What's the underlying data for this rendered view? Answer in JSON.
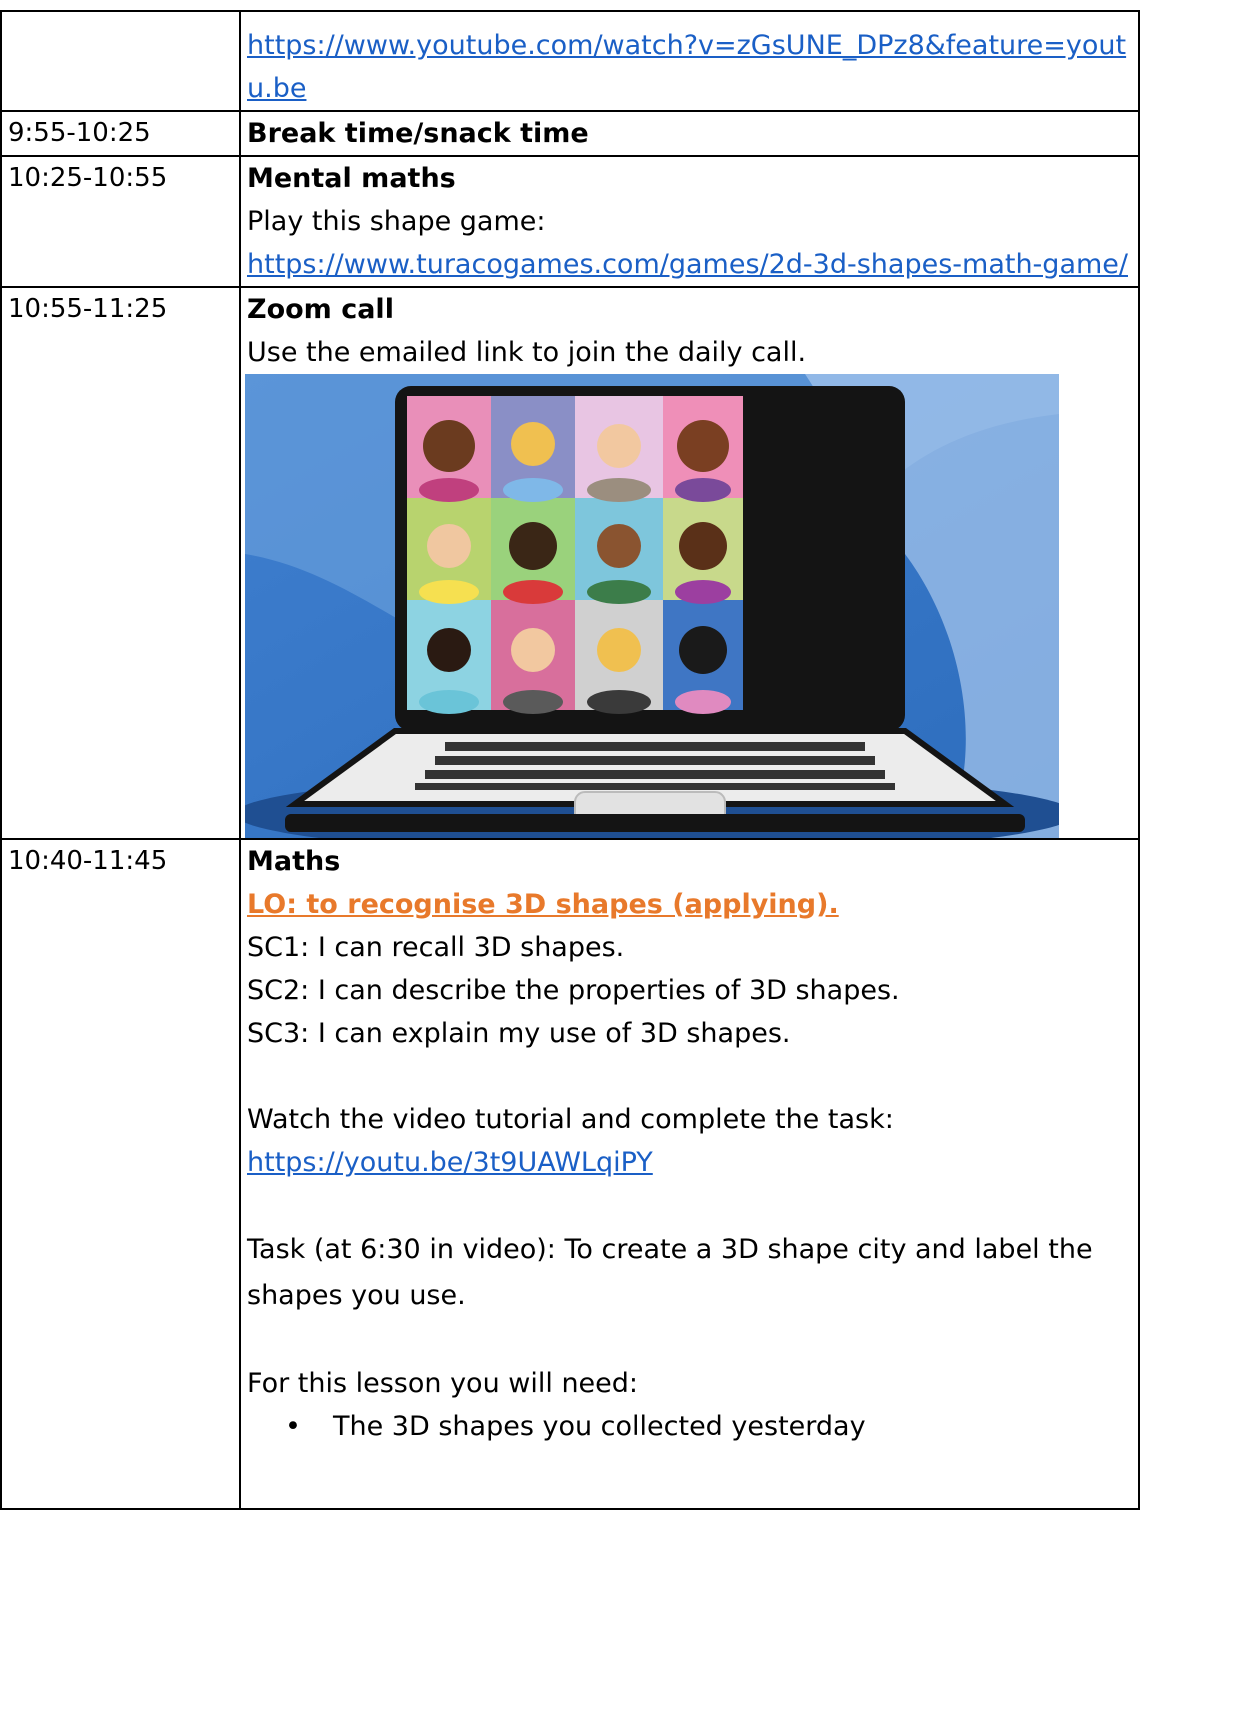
{
  "rows": [
    {
      "time": "",
      "link": "https://www.youtube.com/watch?v=zGsUNE_DPz8&feature=youtu.be"
    },
    {
      "time": "9:55-10:25",
      "title": "Break time/snack time"
    },
    {
      "time": "10:25-10:55",
      "title": "Mental maths",
      "text": "Play this shape game:",
      "link": "https://www.turacogames.com/games/2d-3d-shapes-math-game/"
    },
    {
      "time": "10:55-11:25",
      "title": "Zoom call",
      "text": "Use the emailed link to join the daily call."
    },
    {
      "time": "10:40-11:45",
      "title": "Maths",
      "lo": "LO: to recognise 3D shapes (applying).",
      "criteria": [
        "SC1: I can recall 3D shapes.",
        "SC2: I can describe the properties of 3D shapes.",
        "SC3: I can explain my use of 3D shapes."
      ],
      "watch_text": "Watch the video tutorial and complete the task:",
      "link": "https://youtu.be/3t9UAWLqiPY",
      "task_text": "Task (at 6:30 in video): To create a 3D shape city and label the shapes you use.",
      "need_text": "For this lesson you will need:",
      "bullets": [
        "The 3D shapes you collected yesterday"
      ]
    }
  ],
  "colors": {
    "link": "#1a5fc6",
    "lo": "#e8792b"
  }
}
